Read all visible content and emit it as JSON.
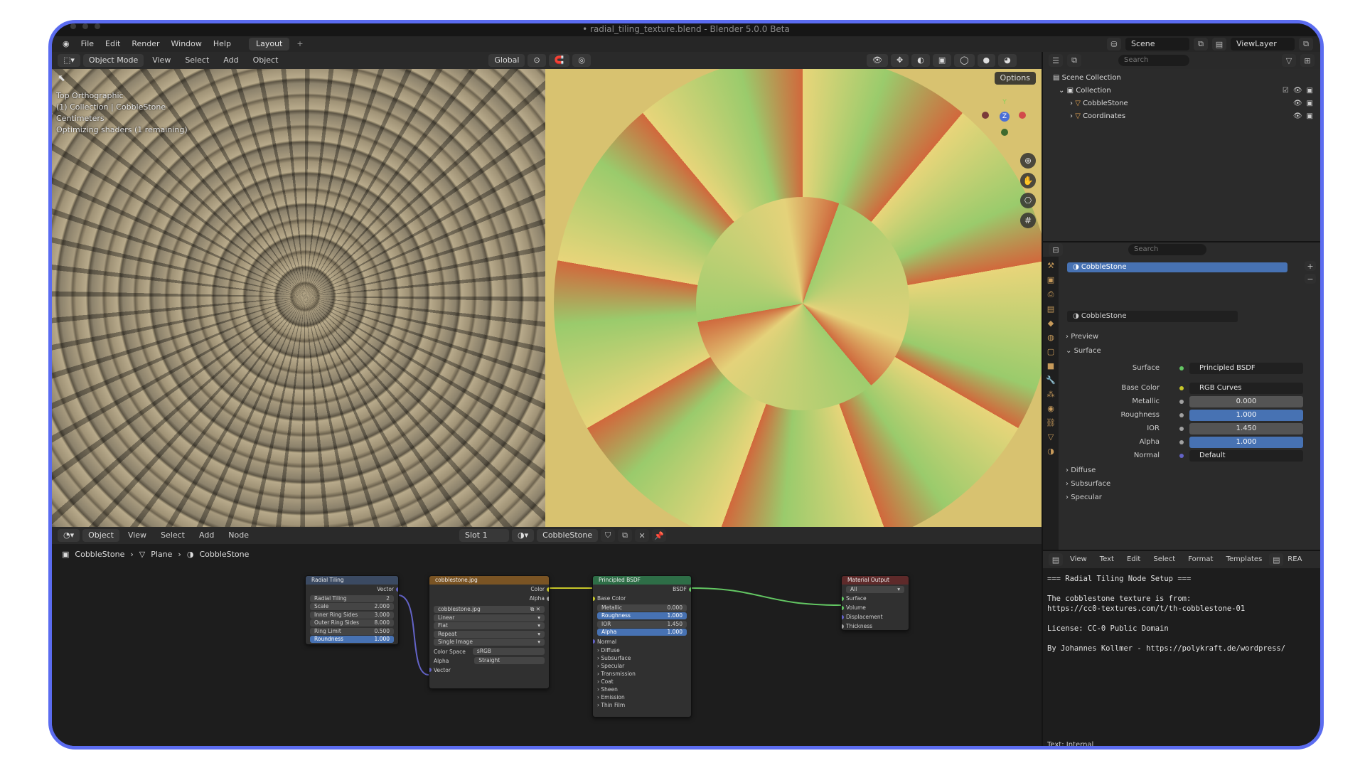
{
  "window": {
    "title": "• radial_tiling_texture.blend - Blender 5.0.0 Beta"
  },
  "menu": {
    "items": [
      "File",
      "Edit",
      "Render",
      "Window",
      "Help"
    ],
    "workspace_tab": "Layout",
    "add_tab": "+",
    "scene": "Scene",
    "view_layer": "ViewLayer"
  },
  "viewport_header": {
    "mode": "Object Mode",
    "menus": [
      "View",
      "Select",
      "Add",
      "Object"
    ],
    "transform_orientation": "Global"
  },
  "viewport": {
    "info_lines": [
      "Top Orthographic",
      "(1) Collection | CobbleStone",
      "Centimeters",
      "Optimizing shaders (1 remaining)"
    ],
    "options_label": "Options",
    "gizmo_axes": {
      "z": "Z",
      "y": "Y"
    }
  },
  "node_header": {
    "editor": "Object",
    "menus": [
      "View",
      "Select",
      "Add",
      "Node"
    ],
    "slot": "Slot 1",
    "material": "CobbleStone"
  },
  "breadcrumb": [
    "CobbleStone",
    "Plane",
    "CobbleStone"
  ],
  "nodes": {
    "radial": {
      "title": "Radial Tiling",
      "output": "Vector",
      "group": "Radial Tiling",
      "group_users": "2",
      "fields": [
        {
          "label": "Scale",
          "value": "2.000"
        },
        {
          "label": "Inner Ring Sides",
          "value": "3.000"
        },
        {
          "label": "Outer Ring Sides",
          "value": "8.000"
        },
        {
          "label": "Ring Limit",
          "value": "0.500"
        },
        {
          "label": "Roundness",
          "value": "1.000"
        }
      ]
    },
    "image": {
      "title": "cobblestone.jpg",
      "outputs": [
        "Color",
        "Alpha"
      ],
      "image_name": "cobblestone.jpg",
      "options": [
        "Linear",
        "Flat",
        "Repeat",
        "Single Image"
      ],
      "color_space_label": "Color Space",
      "color_space": "sRGB",
      "alpha_label": "Alpha",
      "alpha": "Straight",
      "input": "Vector"
    },
    "bsdf": {
      "title": "Principled BSDF",
      "output": "BSDF",
      "base_color": "Base Color",
      "fields": [
        {
          "label": "Metallic",
          "value": "0.000"
        },
        {
          "label": "Roughness",
          "value": "1.000"
        },
        {
          "label": "IOR",
          "value": "1.450"
        },
        {
          "label": "Alpha",
          "value": "1.000"
        }
      ],
      "normal": "Normal",
      "panels": [
        "Diffuse",
        "Subsurface",
        "Specular",
        "Transmission",
        "Coat",
        "Sheen",
        "Emission",
        "Thin Film"
      ]
    },
    "output": {
      "title": "Material Output",
      "target": "All",
      "inputs": [
        "Surface",
        "Volume",
        "Displacement",
        "Thickness"
      ]
    }
  },
  "outliner": {
    "search_placeholder": "Search",
    "scene_collection": "Scene Collection",
    "collection": "Collection",
    "objects": [
      "CobbleStone",
      "Coordinates"
    ]
  },
  "properties": {
    "search_placeholder": "Search",
    "material_slot": "CobbleStone",
    "material_name": "CobbleStone",
    "preview": "Preview",
    "surface_section": "Surface",
    "rows": [
      {
        "label": "Surface",
        "value": "Principled BSDF"
      },
      {
        "label": "Base Color",
        "value": "RGB Curves"
      },
      {
        "label": "Metallic",
        "value": "0.000"
      },
      {
        "label": "Roughness",
        "value": "1.000"
      },
      {
        "label": "IOR",
        "value": "1.450"
      },
      {
        "label": "Alpha",
        "value": "1.000"
      },
      {
        "label": "Normal",
        "value": "Default"
      }
    ],
    "subsections": [
      "Diffuse",
      "Subsurface",
      "Specular"
    ]
  },
  "text_editor": {
    "menus": [
      "View",
      "Text",
      "Edit",
      "Select",
      "Format",
      "Templates"
    ],
    "doc_name": "REA",
    "lines": [
      "=== Radial Tiling Node Setup ===",
      "",
      "The cobblestone texture is from:",
      "https://cc0-textures.com/t/th-cobblestone-01",
      "",
      "License: CC-0 Public Domain",
      "",
      "By Johannes Kollmer - https://polykraft.de/wordpress/"
    ],
    "footer": "Text: Internal"
  },
  "colors": {
    "accent": "#5b6cf0",
    "selection": "#4772b3",
    "socket_yellow": "#c7c729",
    "socket_gray": "#a1a1a1",
    "socket_blue": "#6363c7",
    "socket_green": "#63c763"
  }
}
